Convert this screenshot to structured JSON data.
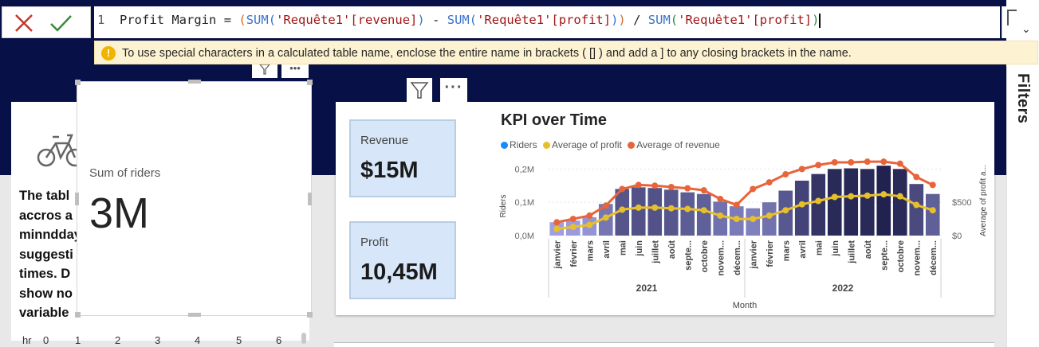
{
  "formula_bar": {
    "line_number": "1",
    "measure_name": "Profit Margin",
    "operator": "=",
    "open_paren": "(",
    "func1": "SUM",
    "arg1": "'Requête1'[revenue]",
    "minus": "-",
    "func2": "SUM",
    "arg2": "'Requête1'[profit]",
    "close_paren": ")",
    "divide": "/",
    "func3": "SUM",
    "arg3": "'Requête1'[profit]",
    "cancel_icon": "close-icon",
    "commit_icon": "check-icon",
    "expand_icon": "chevron-down-icon"
  },
  "warning": {
    "icon": "!",
    "text": "To use special characters in a calculated table name, enclose the entire name in brackets ( [] ) and add a ] to any closing brackets in the name."
  },
  "filters_pane": {
    "label": "Filters"
  },
  "text_visual": {
    "lines": [
      "The tabl",
      "accros a",
      "minndday",
      "suggesti",
      "times. D",
      "show no",
      "variable"
    ],
    "axis": [
      "hr",
      "0",
      "1",
      "2",
      "3",
      "4",
      "5",
      "6"
    ]
  },
  "riders_card": {
    "label": "Sum of riders",
    "value": "3M"
  },
  "kpi_cards": [
    {
      "label": "Revenue",
      "value": "$15M"
    },
    {
      "label": "Profit",
      "value": "10,45M"
    }
  ],
  "colors": {
    "navy": "#081048",
    "riders": "#118dff",
    "profit": "#e6c02c",
    "revenue": "#e8643a",
    "card_fill": "#d7e6f8"
  },
  "chart_data": {
    "type": "bar",
    "title": "KPI over Time",
    "legend": [
      "Riders",
      "Average of profit",
      "Average of revenue"
    ],
    "legend_position": "top-left",
    "xlabel": "Month",
    "ylabel": "Riders",
    "y2label": "Average of profit a...",
    "y_ticks": [
      "0,0M",
      "0,1M",
      "0,2M"
    ],
    "y2_ticks": [
      "$0",
      "$500"
    ],
    "ylim": [
      0,
      0.22
    ],
    "y2lim": [
      0,
      1100
    ],
    "years": [
      "2021",
      "2022"
    ],
    "categories": [
      "janvier",
      "février",
      "mars",
      "avril",
      "mai",
      "juin",
      "juillet",
      "août",
      "septe...",
      "octobre",
      "novem...",
      "décem...",
      "janvier",
      "février",
      "mars",
      "avril",
      "mai",
      "juin",
      "juillet",
      "août",
      "septe...",
      "octobre",
      "novem...",
      "décem..."
    ],
    "series": [
      {
        "name": "Riders",
        "axis": "left",
        "values": [
          0.04,
          0.045,
          0.055,
          0.095,
          0.14,
          0.145,
          0.143,
          0.138,
          0.13,
          0.125,
          0.102,
          0.088,
          0.082,
          0.1,
          0.135,
          0.165,
          0.185,
          0.2,
          0.202,
          0.2,
          0.21,
          0.2,
          0.155,
          0.125
        ]
      },
      {
        "name": "Average of profit",
        "axis": "right",
        "values": [
          100,
          130,
          160,
          270,
          390,
          420,
          420,
          410,
          400,
          380,
          300,
          250,
          250,
          300,
          380,
          470,
          520,
          580,
          590,
          600,
          620,
          590,
          460,
          380
        ]
      },
      {
        "name": "Average of revenue",
        "axis": "right",
        "values": [
          200,
          250,
          300,
          450,
          700,
          760,
          750,
          730,
          710,
          680,
          550,
          460,
          700,
          800,
          920,
          1000,
          1060,
          1100,
          1100,
          1110,
          1110,
          1080,
          880,
          760
        ]
      }
    ]
  }
}
